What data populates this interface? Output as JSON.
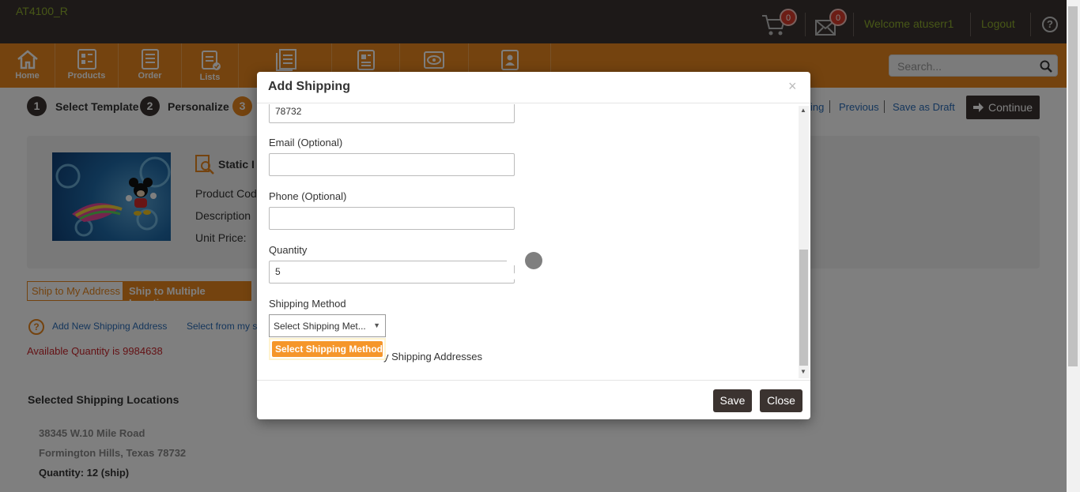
{
  "header": {
    "brand": "AT4100_R",
    "cart_count": "0",
    "mail_count": "0",
    "welcome": "Welcome atuserr1",
    "logout": "Logout",
    "help": "?"
  },
  "nav": {
    "items": [
      {
        "label": "Home",
        "icon": "home-icon"
      },
      {
        "label": "Products",
        "icon": "products-icon"
      },
      {
        "label": "Order",
        "icon": "order-icon"
      },
      {
        "label": "Lists",
        "icon": "lists-icon"
      },
      {
        "label": "",
        "icon": "documents-icon"
      },
      {
        "label": "",
        "icon": "report-icon"
      },
      {
        "label": "",
        "icon": "proof-icon"
      },
      {
        "label": "",
        "icon": "contacts-icon"
      }
    ],
    "search_placeholder": "Search..."
  },
  "steps": {
    "step1_num": "1",
    "step1_label": "Select Template",
    "step2_num": "2",
    "step2_label": "Personalize",
    "step3_num": "3",
    "link_partial": "ing",
    "previous": "Previous",
    "save_draft": "Save as Draft",
    "continue": "Continue"
  },
  "product": {
    "title": "Static I",
    "code_label": "Product Code",
    "desc_label": "Description",
    "price_label": "Unit Price:"
  },
  "shipping": {
    "tab_my": "Ship to My Address",
    "tab_multi": "Ship to Multiple Locations",
    "add_new": "Add New Shipping Address",
    "select_from": "Select from my s",
    "available": "Available Quantity is 9984638",
    "selected_title": "Selected Shipping Locations",
    "addr_line1": "38345 W.10 Mile Road",
    "addr_line2": "Formington Hills, Texas 78732",
    "qty_line": "Quantity: 12 (ship)"
  },
  "modal": {
    "title": "Add Shipping",
    "close_x": "×",
    "zip_value": "78732",
    "email_label": "Email (Optional)",
    "email_value": "",
    "phone_label": "Phone (Optional)",
    "phone_value": "",
    "quantity_label": "Quantity",
    "quantity_value": "5",
    "method_label": "Shipping Method",
    "method_selected": "Select Shipping Met...",
    "method_option": "Select Shipping Method",
    "addresses_text": "y Shipping Addresses",
    "save": "Save",
    "close": "Close"
  },
  "colors": {
    "topbar": "#3b3330",
    "accent": "#e8871e",
    "brand_green": "#8fae2e",
    "badge_red": "#d93a2b",
    "error_red": "#c8242b"
  }
}
